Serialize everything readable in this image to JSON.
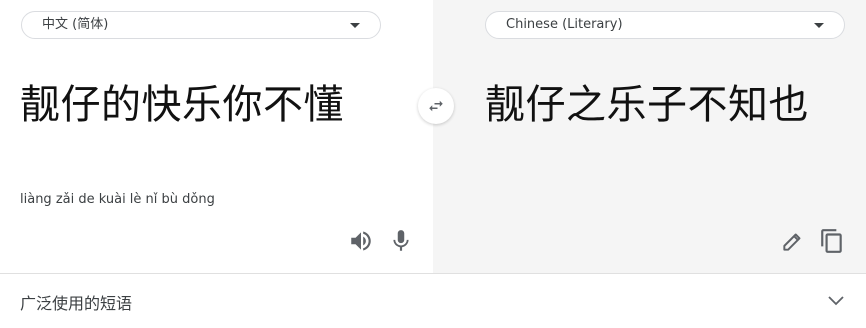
{
  "source": {
    "language": "中文 (简体)",
    "text": "靓仔的快乐你不懂",
    "romanization": "liàng zǎi de kuài lè nǐ bù dǒng"
  },
  "target": {
    "language": "Chinese (Literary)",
    "text": "靓仔之乐子不知也"
  },
  "phrases": {
    "label": "广泛使用的短语"
  },
  "icons": {
    "swap": "swap-icon",
    "speaker": "speaker-icon",
    "mic": "mic-icon",
    "edit": "pencil-icon",
    "copy": "copy-icon",
    "expand": "chevron-down-icon",
    "dropdown": "caret-down-icon"
  },
  "colors": {
    "icon": "#5f6368",
    "target_pane_bg": "#f5f5f5"
  }
}
